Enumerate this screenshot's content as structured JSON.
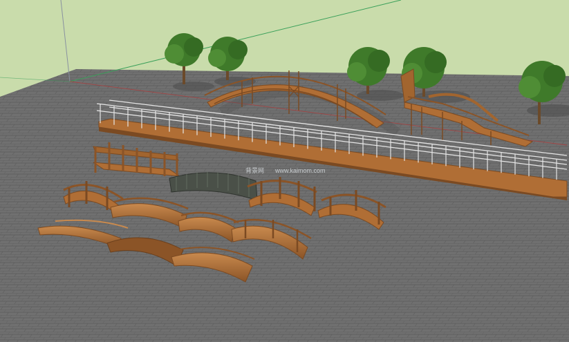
{
  "scene": {
    "watermark_cn": "背景网",
    "watermark_url": "www.kaimom.com",
    "colors": {
      "sky": "#c9dcab",
      "pavement": "#6f6f6f",
      "pavement_line": "#5d5d5d",
      "wood": "#b06e35",
      "wood_dark": "#7b4a22",
      "wood_light": "#c98a4e",
      "rail": "#e6e6e6",
      "tree": "#3f7a2a",
      "shadow": "#4f4f4f",
      "axis_red": "#b23a3a",
      "axis_green": "#3aa05a",
      "axis_blue": "#8890a0"
    },
    "icons": [
      "tree-icon"
    ]
  }
}
